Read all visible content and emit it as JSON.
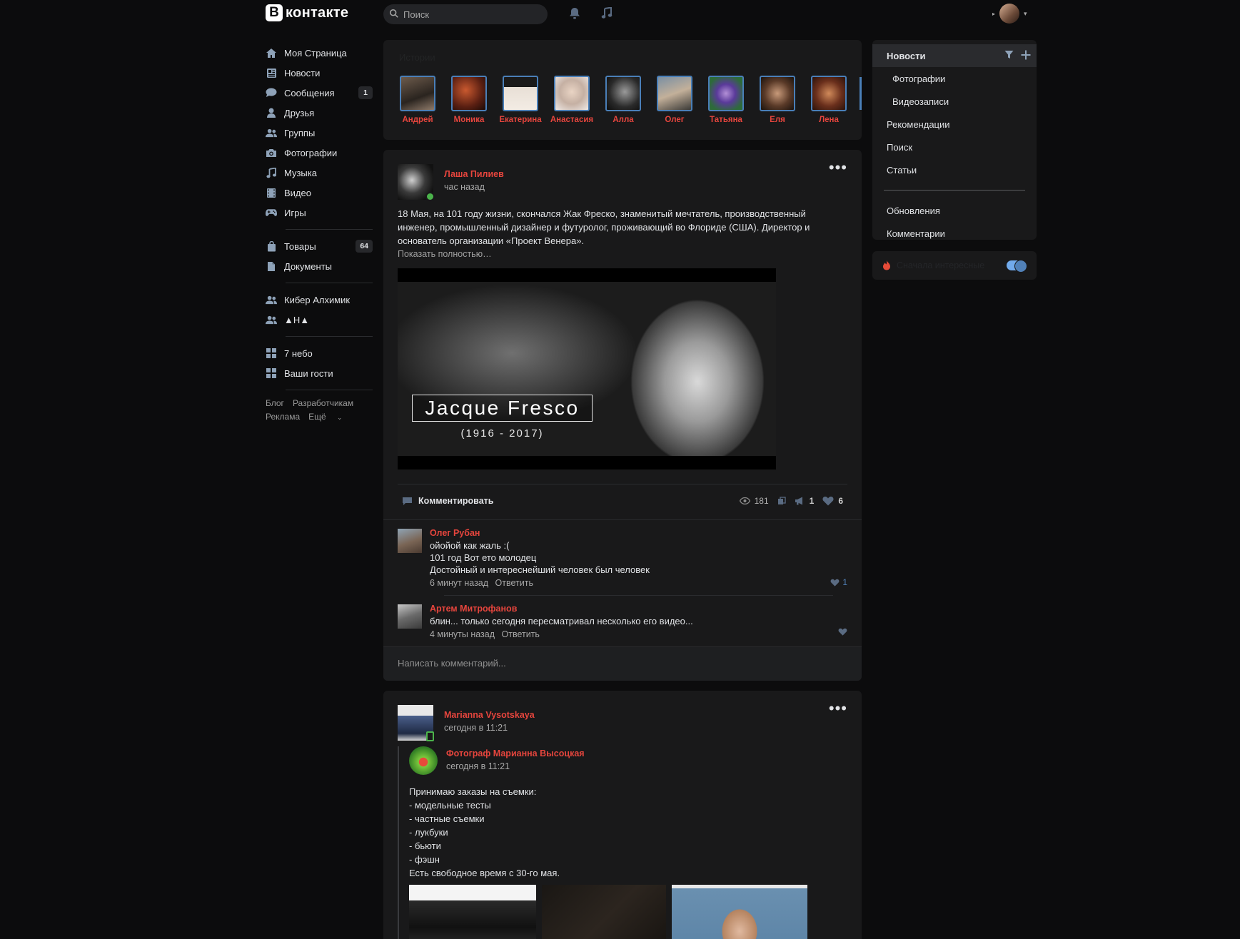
{
  "header": {
    "logo_letter": "В",
    "logo_text": "контакте",
    "search_placeholder": "Поиск"
  },
  "leftnav": {
    "items": [
      {
        "label": "Моя Страница",
        "icon": "home-icon"
      },
      {
        "label": "Новости",
        "icon": "news-icon"
      },
      {
        "label": "Сообщения",
        "icon": "messages-icon",
        "count": "1"
      },
      {
        "label": "Друзья",
        "icon": "friends-icon"
      },
      {
        "label": "Группы",
        "icon": "groups-icon"
      },
      {
        "label": "Фотографии",
        "icon": "camera-icon"
      },
      {
        "label": "Музыка",
        "icon": "music-icon"
      },
      {
        "label": "Видео",
        "icon": "video-icon"
      },
      {
        "label": "Игры",
        "icon": "gamepad-icon"
      }
    ],
    "items2": [
      {
        "label": "Товары",
        "icon": "bag-icon",
        "count": "64"
      },
      {
        "label": "Документы",
        "icon": "document-icon"
      }
    ],
    "items3": [
      {
        "label": "Кибер Алхимик",
        "icon": "groups-icon"
      },
      {
        "label": "▲Н▲",
        "icon": "groups-icon"
      }
    ],
    "items4": [
      {
        "label": "7 небо",
        "icon": "apps-icon"
      },
      {
        "label": "Ваши гости",
        "icon": "apps-icon"
      }
    ],
    "footer": [
      "Блог",
      "Разработчикам",
      "Реклама",
      "Ещё"
    ]
  },
  "stories": {
    "title": "Истории",
    "people": [
      "Андрей",
      "Моника",
      "Екатерина",
      "Анастасия",
      "Алла",
      "Олег",
      "Татьяна",
      "Еля",
      "Лена"
    ]
  },
  "post1": {
    "author": "Лаша Пилиев",
    "time": "час назад",
    "text": "18 Мая, на 101 году жизни, скончался Жак Фреско, знаменитый мечтатель, производственный инженер, промышленный дизайнер и футуролог, проживающий во Флориде (США). Директор и основатель организации «Проект Венера».",
    "show_more": "Показать полностью…",
    "image_title": "Jacque Fresco",
    "image_years": "(1916 - 2017)",
    "comment_label": "Комментировать",
    "views": "181",
    "reposts": "1",
    "likes": "6",
    "comments": [
      {
        "name": "Олег Рубан",
        "lines": [
          "ойойой как жаль :(",
          "101 год Вот ето молодец",
          "Достойный и интереснейший человек был человек"
        ],
        "time": "6 минут назад",
        "reply": "Ответить",
        "likes": "1"
      },
      {
        "name": "Артем Митрофанов",
        "lines": [
          "блин... только сегодня пересматривал несколько его видео..."
        ],
        "time": "4 минуты назад",
        "reply": "Ответить",
        "likes": ""
      }
    ],
    "write_placeholder": "Написать комментарий..."
  },
  "post2": {
    "author": "Marianna Vysotskaya",
    "time": "сегодня в 11:21",
    "repost_author": "Фотограф Марианна Высоцкая",
    "repost_time": "сегодня в 11:21",
    "text": "Принимаю заказы на съемки:\n- модельные тесты\n- частные съемки\n- лукбуки\n- бьюти\n- фэшн\nЕсть свободное время с 30-го мая."
  },
  "rightnav": {
    "items": [
      {
        "label": "Новости",
        "active": true
      },
      {
        "label": "Фотографии",
        "sub": true
      },
      {
        "label": "Видеозаписи",
        "sub": true
      },
      {
        "label": "Рекомендации"
      },
      {
        "label": "Поиск"
      },
      {
        "label": "Статьи"
      }
    ],
    "items2": [
      {
        "label": "Обновления"
      },
      {
        "label": "Комментарии"
      }
    ],
    "interesting_label": "Сначала интересные"
  },
  "colors": {
    "accent_red": "#e6453d",
    "accent_blue": "#5181b8",
    "background": "#0c0c0d",
    "card": "#19191a"
  }
}
